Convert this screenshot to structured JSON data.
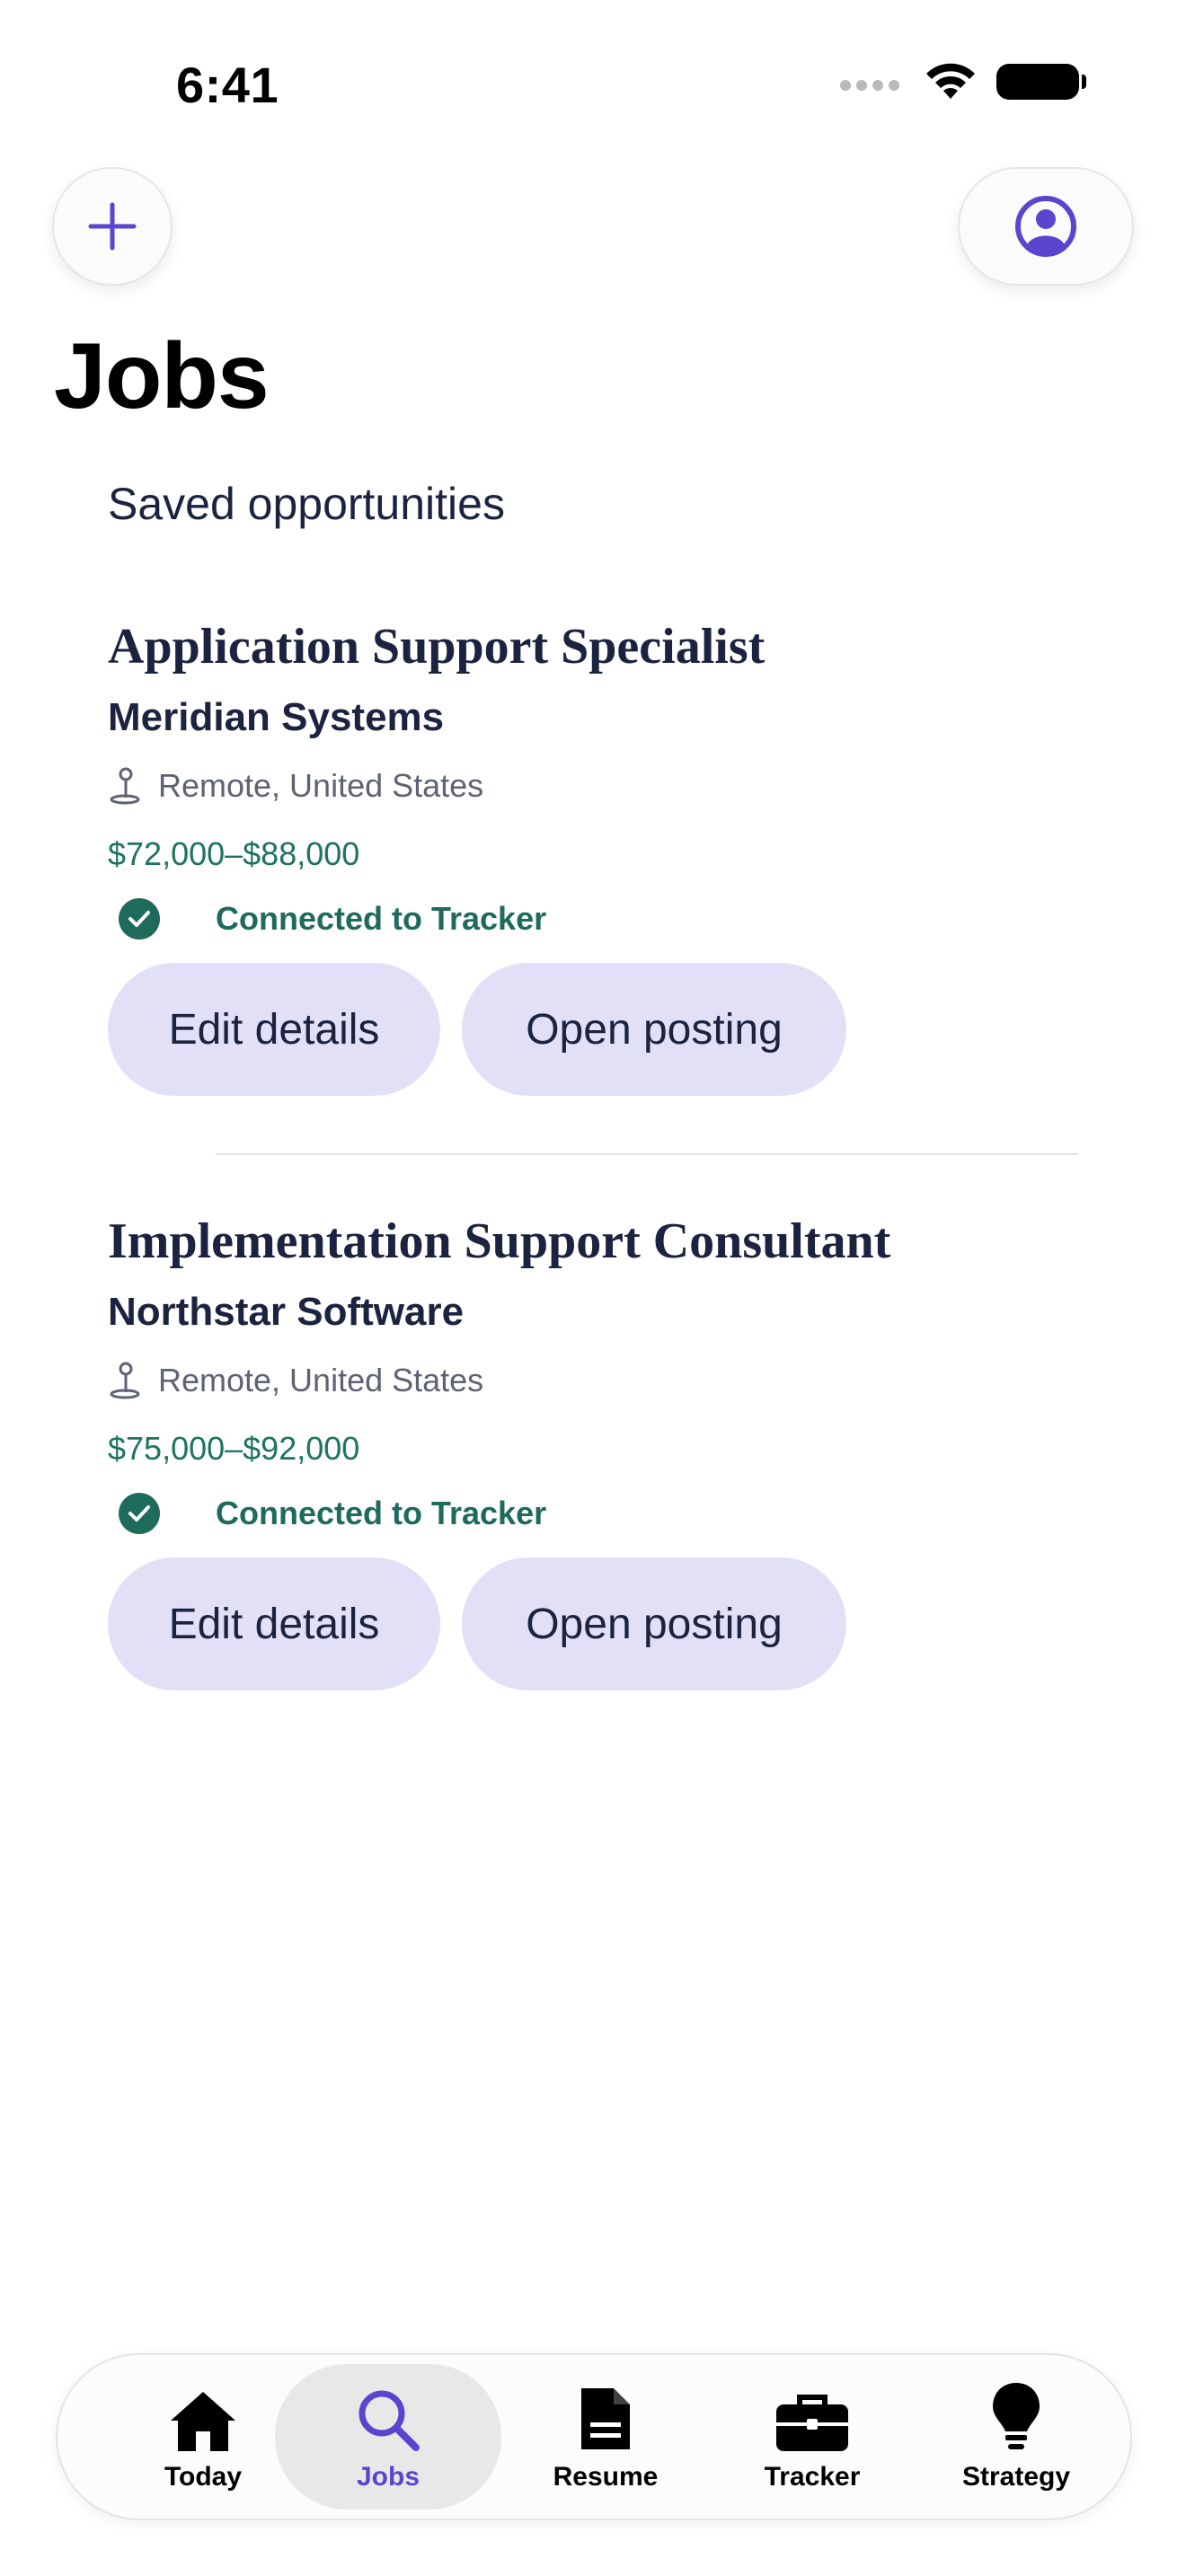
{
  "status_bar": {
    "time": "6:41"
  },
  "header": {
    "title": "Jobs",
    "section_title": "Saved opportunities"
  },
  "jobs": [
    {
      "title": "Application Support Specialist",
      "company": "Meridian Systems",
      "location": "Remote, United States",
      "salary": "$72,000–$88,000",
      "status": "Connected to Tracker",
      "edit_label": "Edit details",
      "open_label": "Open posting"
    },
    {
      "title": "Implementation Support Consultant",
      "company": "Northstar Software",
      "location": "Remote, United States",
      "salary": "$75,000–$92,000",
      "status": "Connected to Tracker",
      "edit_label": "Edit details",
      "open_label": "Open posting"
    }
  ],
  "tabbar": {
    "items": [
      {
        "label": "Today",
        "icon": "house-icon"
      },
      {
        "label": "Jobs",
        "icon": "search-icon"
      },
      {
        "label": "Resume",
        "icon": "document-icon"
      },
      {
        "label": "Tracker",
        "icon": "briefcase-icon"
      },
      {
        "label": "Strategy",
        "icon": "lightbulb-icon"
      }
    ],
    "active": "Jobs"
  },
  "colors": {
    "accent": "#5b45cf",
    "success": "#1e6b5b",
    "pill_background": "#e2e0f6",
    "text_primary": "#1b2340"
  }
}
